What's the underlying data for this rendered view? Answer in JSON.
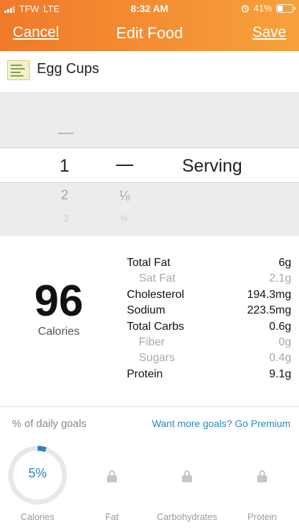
{
  "status_bar": {
    "carrier": "TFW",
    "network": "LTE",
    "time": "8:32 AM",
    "battery_text": "41%",
    "battery_level": 0.41
  },
  "nav": {
    "cancel_label": "Cancel",
    "title": "Edit Food",
    "save_label": "Save"
  },
  "food": {
    "name": "Egg Cups"
  },
  "picker": {
    "above_mark": "—",
    "selected_number": "1",
    "selected_fraction": "—",
    "selected_unit": "Serving",
    "next_number": "2",
    "next_fraction": "⅛",
    "next2_number": "3",
    "next2_fraction": "¼"
  },
  "nutrition": {
    "calories_value": "96",
    "calories_label": "Calories",
    "rows": [
      {
        "label": "Total Fat",
        "value": "6g",
        "sub": false
      },
      {
        "label": "Sat Fat",
        "value": "2.1g",
        "sub": true
      },
      {
        "label": "Cholesterol",
        "value": "194.3mg",
        "sub": false
      },
      {
        "label": "Sodium",
        "value": "223.5mg",
        "sub": false
      },
      {
        "label": "Total Carbs",
        "value": "0.6g",
        "sub": false
      },
      {
        "label": "Fiber",
        "value": "0g",
        "sub": true
      },
      {
        "label": "Sugars",
        "value": "0.4g",
        "sub": true
      },
      {
        "label": "Protein",
        "value": "9.1g",
        "sub": false
      }
    ]
  },
  "goals": {
    "title": "% of daily goals",
    "premium_link": "Want more goals? Go Premium",
    "calories_percent_text": "5%",
    "calories_fraction": 0.05,
    "labels": {
      "calories": "Calories",
      "fat": "Fat",
      "carbs": "Carbohydrates",
      "protein": "Protein"
    },
    "icons": [
      "lock-icon",
      "lock-icon",
      "lock-icon"
    ]
  },
  "colors": {
    "header_start": "#f07a2a",
    "header_end": "#f7a13c",
    "accent_blue": "#2a86c6"
  }
}
